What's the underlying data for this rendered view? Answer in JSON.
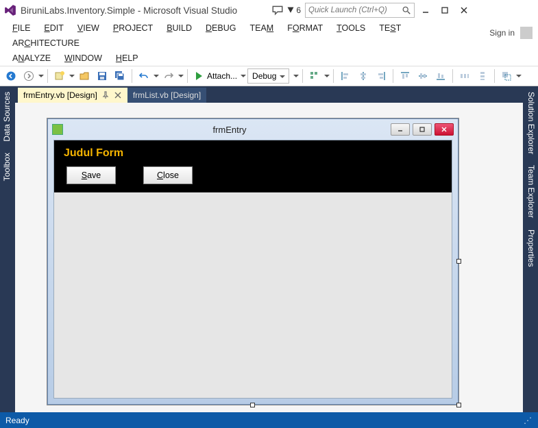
{
  "window": {
    "title": "BiruniLabs.Inventory.Simple - Microsoft Visual Studio",
    "notif_count": "6",
    "search_placeholder": "Quick Launch (Ctrl+Q)",
    "signin": "Sign in"
  },
  "menu": {
    "file": "FILE",
    "edit": "EDIT",
    "view": "VIEW",
    "project": "PROJECT",
    "build": "BUILD",
    "debug": "DEBUG",
    "team": "TEAM",
    "format": "FORMAT",
    "tools": "TOOLS",
    "test": "TEST",
    "architecture": "ARCHITECTURE",
    "analyze": "ANALYZE",
    "window": "WINDOW",
    "help": "HELP"
  },
  "toolbar": {
    "attach": "Attach...",
    "config": "Debug"
  },
  "tabs": {
    "active": "frmEntry.vb [Design]",
    "inactive": "frmList.vb [Design]"
  },
  "side": {
    "data_sources": "Data Sources",
    "toolbox": "Toolbox",
    "solution_explorer": "Solution Explorer",
    "team_explorer": "Team Explorer",
    "properties": "Properties"
  },
  "form": {
    "caption": "frmEntry",
    "header": "Judul Form",
    "save": "Save",
    "close": "Close"
  },
  "status": {
    "ready": "Ready"
  }
}
